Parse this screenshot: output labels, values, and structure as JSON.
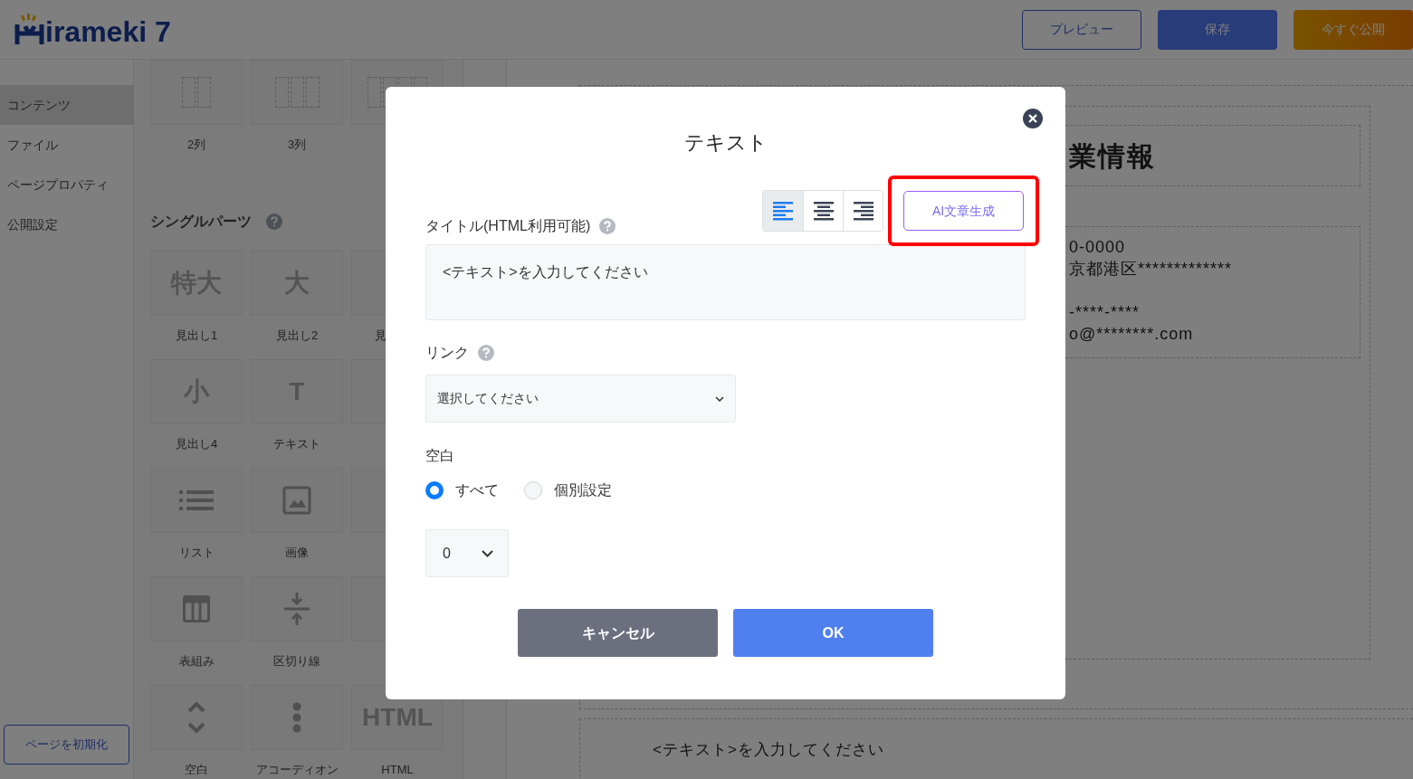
{
  "header": {
    "logo_text": "irameki 7",
    "buttons": [
      {
        "label": "プレビュー",
        "kind": "outline"
      },
      {
        "label": "保存",
        "kind": "primary"
      },
      {
        "label": "今すぐ公開",
        "kind": "accent"
      }
    ]
  },
  "sidebar": {
    "items": [
      {
        "label": "コンテンツ",
        "selected": true
      },
      {
        "label": "ファイル",
        "selected": false
      },
      {
        "label": "ページプロパティ",
        "selected": false
      },
      {
        "label": "公開設定",
        "selected": false
      }
    ],
    "reset_button": "ページを初期化"
  },
  "layout_parts": [
    {
      "kind": "two_columns",
      "label": "2列"
    },
    {
      "kind": "three_columns",
      "label": "3列"
    },
    {
      "kind": "four_columns"
    }
  ],
  "single_parts": {
    "title": "シングルパーツ",
    "items": [
      {
        "kind": "glyph",
        "glyph": "特大",
        "label": "見出し1"
      },
      {
        "kind": "glyph",
        "glyph": "大",
        "label": "見出し2"
      },
      {
        "kind": "hidden",
        "label": "見"
      },
      {
        "kind": "glyph",
        "glyph": "小",
        "label": "見出し4"
      },
      {
        "kind": "glyph",
        "glyph": "T",
        "label": "テキスト"
      },
      {
        "kind": "hidden"
      },
      {
        "kind": "list",
        "label": "リスト"
      },
      {
        "kind": "image",
        "label": "画像"
      },
      {
        "kind": "hidden"
      },
      {
        "kind": "table",
        "label": "表組み"
      },
      {
        "kind": "divider",
        "label": "区切り線"
      },
      {
        "kind": "hidden"
      },
      {
        "kind": "spacer",
        "label": "空白"
      },
      {
        "kind": "dots",
        "label": "アコーディオン"
      },
      {
        "kind": "glyph",
        "glyph": "HTML",
        "label": "HTML"
      }
    ]
  },
  "canvas": {
    "heading": "業情報",
    "address_lines": [
      "0-0000",
      "京都港区*************"
    ],
    "contact_lines": [
      "-****-****",
      "o@********.com"
    ],
    "text_block": "<テキスト>を入力してください"
  },
  "dialog": {
    "title": "テキスト",
    "title_field": {
      "label": "タイトル(HTML利用可能)",
      "value": "<テキスト>を入力してください"
    },
    "align_buttons": [
      {
        "kind": "left",
        "selected": true
      },
      {
        "kind": "center",
        "selected": false
      },
      {
        "kind": "right",
        "selected": false
      }
    ],
    "ai_button": {
      "label": "AI文章生成",
      "highlighted": true
    },
    "link": {
      "label": "リンク",
      "value": "選択してください"
    },
    "spacing": {
      "label": "空白",
      "options": [
        {
          "label": "すべて",
          "selected": true
        },
        {
          "label": "個別設定",
          "selected": false
        }
      ],
      "value": "0"
    },
    "buttons": [
      {
        "label": "キャンセル",
        "kind": "cancel"
      },
      {
        "label": "OK",
        "kind": "ok"
      }
    ]
  }
}
